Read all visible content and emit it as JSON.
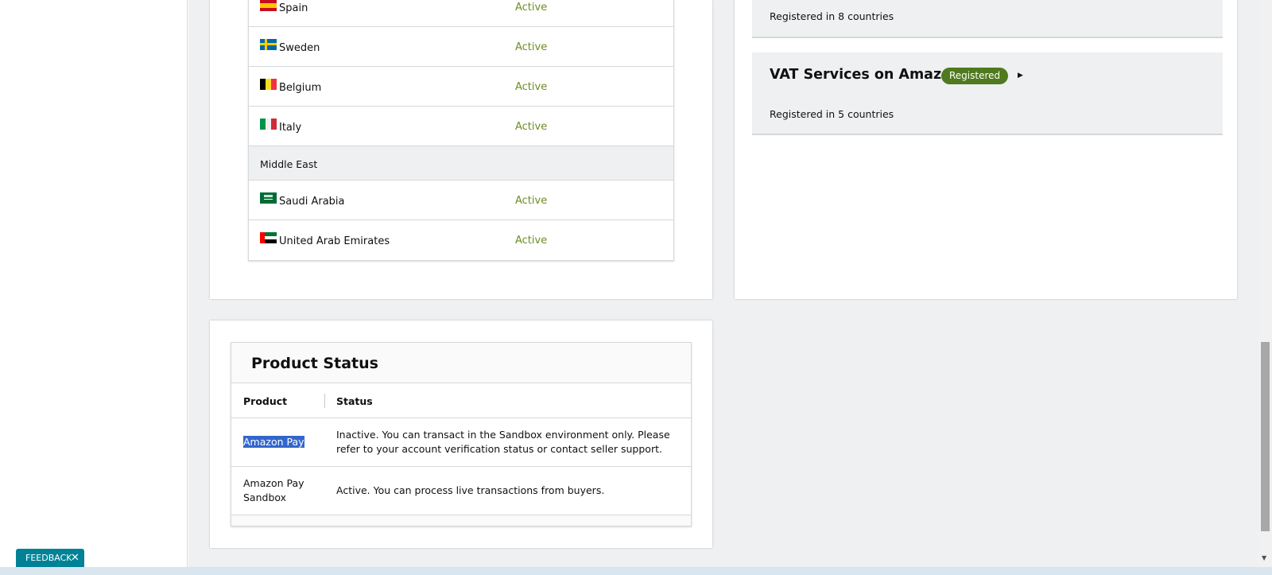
{
  "countries": {
    "rows": [
      {
        "type": "country",
        "name": "Spain",
        "status": "Active",
        "flag": "spain-flag"
      },
      {
        "type": "country",
        "name": "Sweden",
        "status": "Active",
        "flag": "sweden-flag"
      },
      {
        "type": "country",
        "name": "Belgium",
        "status": "Active",
        "flag": "belgium-flag"
      },
      {
        "type": "country",
        "name": "Italy",
        "status": "Active",
        "flag": "italy-flag"
      },
      {
        "type": "group",
        "name": "Middle East"
      },
      {
        "type": "country",
        "name": "Saudi Arabia",
        "status": "Active",
        "flag": "saudi-arabia-flag"
      },
      {
        "type": "country",
        "name": "United Arab Emirates",
        "status": "Active",
        "flag": "uae-flag"
      }
    ]
  },
  "registrations": {
    "first": {
      "count_text": "Registered in 8 countries"
    },
    "vat": {
      "title": "VAT Services on Amazon",
      "badge": "Registered",
      "count_text": "Registered in 5 countries",
      "arrow_icon": "caret-right-icon"
    }
  },
  "product_status": {
    "title": "Product Status",
    "headers": {
      "product": "Product",
      "status": "Status"
    },
    "rows": [
      {
        "product": "Amazon Pay",
        "status": "Inactive. You can transact in the Sandbox environment only. Please refer to your account verification status or contact seller support."
      },
      {
        "product": "Amazon Pay Sandbox",
        "status": "Active. You can process live transactions from buyers."
      }
    ]
  },
  "feedback": {
    "label": "FEEDBACK",
    "close": "✕"
  },
  "colors": {
    "active_status": "#6b8e23",
    "badge_bg": "#4f7a1d",
    "feedback_bg": "#008296",
    "selection": "#3366cc"
  }
}
